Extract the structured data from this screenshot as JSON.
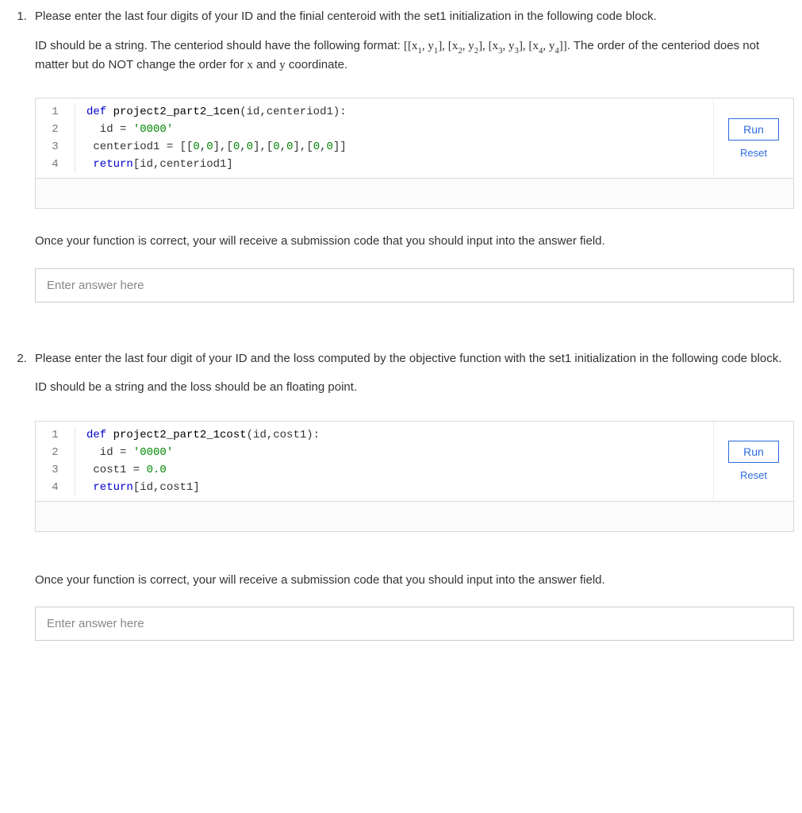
{
  "questions": [
    {
      "num": "1.",
      "para1_a": "Please enter the last four digits of your ID and the finial centeroid with the set1 initialization in the following code block.",
      "para2_a": "ID should be a string. The centeriod should have the following format: ",
      "format_math_html": "[[x₁, y₁], [x₂, y₂], [x₃, y₃], [x₄, y₄]]",
      "para2_b": ". The order of the centeriod does not matter but do NOT change the order for ",
      "xvar": "x",
      "and": " and ",
      "yvar": "y",
      "para2_c": " coordinate.",
      "code": {
        "lines": [
          "1",
          "2",
          "3",
          "4"
        ],
        "l1_kw": "def ",
        "l1_fn": "project2_part2_1cen",
        "l1_rest": "(id,centeriod1):",
        "l2_a": "  id = ",
        "l2_str": "'0000'",
        "l3_a": " centeriod1 = [[",
        "l3_n1": "0",
        "l3_c1": ",",
        "l3_n2": "0",
        "l3_c2": "],[",
        "l3_n3": "0",
        "l3_c3": ",",
        "l3_n4": "0",
        "l3_c4": "],[",
        "l3_n5": "0",
        "l3_c5": ",",
        "l3_n6": "0",
        "l3_c6": "],[",
        "l3_n7": "0",
        "l3_c7": ",",
        "l3_n8": "0",
        "l3_c8": "]]",
        "l4_kw": " return",
        "l4_rest": "[id,centeriod1]"
      },
      "run_label": "Run",
      "reset_label": "Reset",
      "post_text": "Once your function is correct, your will receive a submission code that you should input into the answer field.",
      "answer_placeholder": "Enter answer here"
    },
    {
      "num": "2.",
      "para1_a": "Please enter the last four digit of your ID and the loss computed by the objective function with the set1 initialization in the following code block.",
      "para2_a": "ID should be a string and the loss should be an floating point.",
      "code": {
        "lines": [
          "1",
          "2",
          "3",
          "4"
        ],
        "l1_kw": "def ",
        "l1_fn": "project2_part2_1cost",
        "l1_rest": "(id,cost1):",
        "l2_a": "  id = ",
        "l2_str": "'0000'",
        "l3_a": " cost1 = ",
        "l3_num": "0.0",
        "l4_kw": " return",
        "l4_rest": "[id,cost1]"
      },
      "run_label": "Run",
      "reset_label": "Reset",
      "post_text": "Once your function is correct, your will receive a submission code that you should input into the answer field.",
      "answer_placeholder": "Enter answer here"
    }
  ]
}
